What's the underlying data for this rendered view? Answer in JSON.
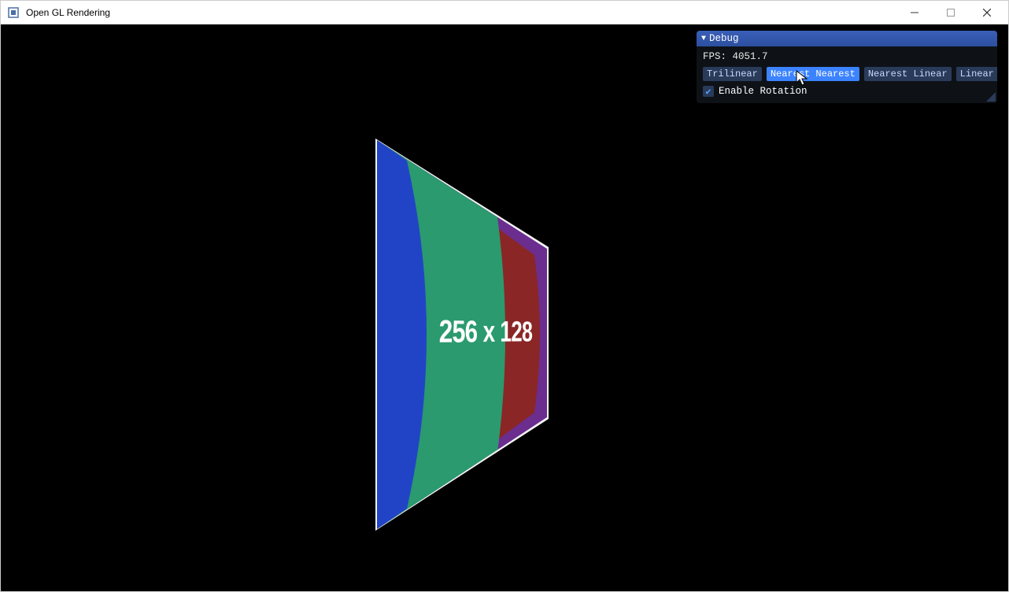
{
  "window": {
    "title": "Open GL Rendering"
  },
  "render": {
    "texture_label": "256 x 128"
  },
  "debug_panel": {
    "title": "Debug",
    "fps_label": "FPS:",
    "fps_value": "4051.7",
    "buttons": {
      "trilinear": "Trilinear",
      "nearest_nearest": "Nearest Nearest",
      "nearest_linear": "Nearest Linear",
      "linear_nearest": "Linear Nearest"
    },
    "active_button": "nearest_nearest",
    "checkbox": {
      "label": "Enable Rotation",
      "checked": true
    }
  }
}
